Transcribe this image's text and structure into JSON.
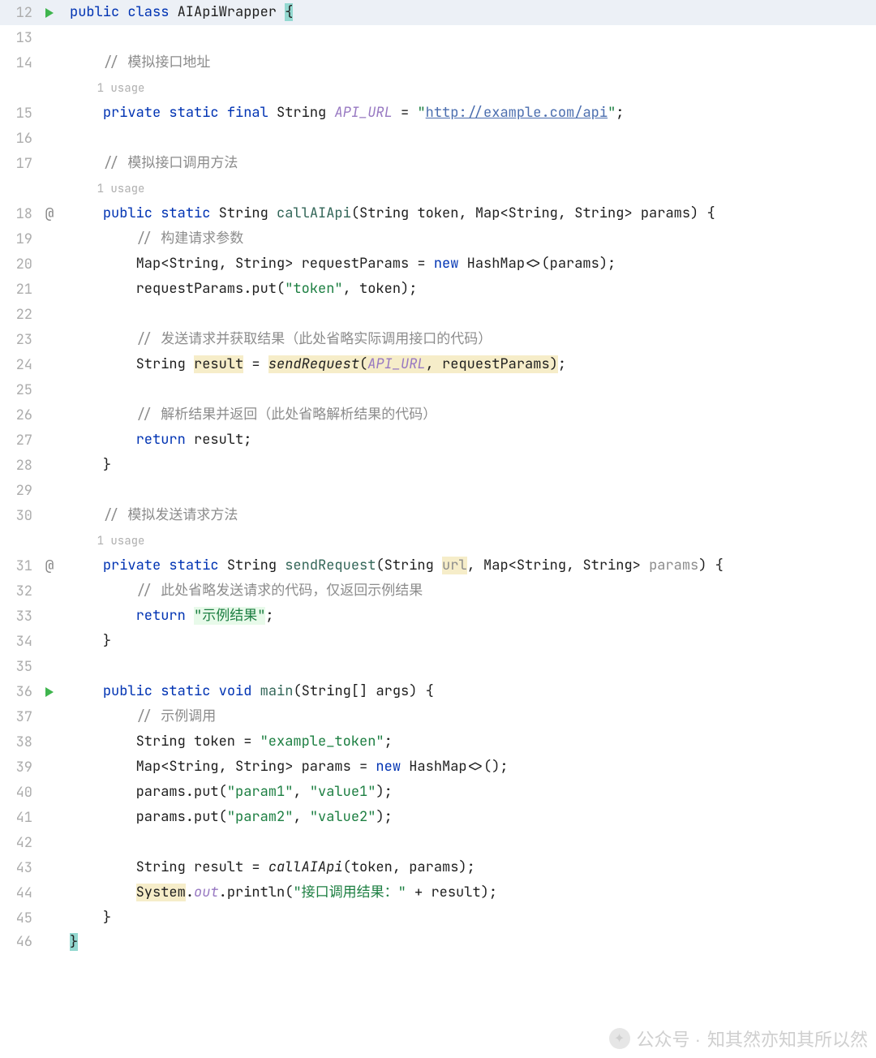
{
  "first_line_number": 12,
  "usage_hint_label": "1 usage",
  "watermark": {
    "prefix": "公众号 ·",
    "text": "知其然亦知其所以然"
  },
  "lines": [
    {
      "n": 12,
      "hl": true,
      "icon": "run",
      "tokens": [
        {
          "t": "public",
          "c": "kw"
        },
        {
          "t": " "
        },
        {
          "t": "class",
          "c": "kw"
        },
        {
          "t": " AIApiWrapper "
        },
        {
          "t": "{",
          "c": "brace-match"
        }
      ]
    },
    {
      "n": 13,
      "tokens": []
    },
    {
      "n": 14,
      "indent": 1,
      "tokens": [
        {
          "t": "// 模拟接口地址",
          "c": "comment"
        }
      ]
    },
    {
      "usage": true,
      "indent": 1
    },
    {
      "n": 15,
      "indent": 1,
      "tokens": [
        {
          "t": "private",
          "c": "kw"
        },
        {
          "t": " "
        },
        {
          "t": "static",
          "c": "kw"
        },
        {
          "t": " "
        },
        {
          "t": "final",
          "c": "kw"
        },
        {
          "t": " String "
        },
        {
          "t": "API_URL",
          "c": "field-static"
        },
        {
          "t": " = "
        },
        {
          "t": "\"",
          "c": "str"
        },
        {
          "t": "http://example.com/api",
          "c": "str link"
        },
        {
          "t": "\"",
          "c": "str"
        },
        {
          "t": ";"
        }
      ]
    },
    {
      "n": 16,
      "tokens": []
    },
    {
      "n": 17,
      "indent": 1,
      "tokens": [
        {
          "t": "// 模拟接口调用方法",
          "c": "comment"
        }
      ]
    },
    {
      "usage": true,
      "indent": 1
    },
    {
      "n": 18,
      "icon": "override",
      "indent": 1,
      "tokens": [
        {
          "t": "public",
          "c": "kw"
        },
        {
          "t": " "
        },
        {
          "t": "static",
          "c": "kw"
        },
        {
          "t": " String "
        },
        {
          "t": "callAIApi",
          "c": "method-decl"
        },
        {
          "t": "(String token, Map<String, String> params) {"
        }
      ]
    },
    {
      "n": 19,
      "indent": 2,
      "tokens": [
        {
          "t": "// 构建请求参数",
          "c": "comment"
        }
      ]
    },
    {
      "n": 20,
      "indent": 2,
      "tokens": [
        {
          "t": "Map<String, String> requestParams = "
        },
        {
          "t": "new",
          "c": "kw"
        },
        {
          "t": " HashMap<>(params);"
        }
      ]
    },
    {
      "n": 21,
      "indent": 2,
      "tokens": [
        {
          "t": "requestParams.put("
        },
        {
          "t": "\"token\"",
          "c": "str"
        },
        {
          "t": ", token);"
        }
      ]
    },
    {
      "n": 22,
      "tokens": []
    },
    {
      "n": 23,
      "indent": 2,
      "tokens": [
        {
          "t": "// 发送请求并获取结果（此处省略实际调用接口的代码）",
          "c": "comment"
        }
      ]
    },
    {
      "n": 24,
      "indent": 2,
      "tokens": [
        {
          "t": "String "
        },
        {
          "t": "result",
          "c": "hl-y"
        },
        {
          "t": " = "
        },
        {
          "t": "sendRequest",
          "c": "method-call hl-y"
        },
        {
          "t": "(",
          "c": "hl-y"
        },
        {
          "t": "API_URL",
          "c": "field-static hl-y"
        },
        {
          "t": ", requestParams)",
          "c": "hl-y"
        },
        {
          "t": ";"
        }
      ]
    },
    {
      "n": 25,
      "tokens": []
    },
    {
      "n": 26,
      "indent": 2,
      "tokens": [
        {
          "t": "// 解析结果并返回（此处省略解析结果的代码）",
          "c": "comment"
        }
      ]
    },
    {
      "n": 27,
      "indent": 2,
      "tokens": [
        {
          "t": "return",
          "c": "kw"
        },
        {
          "t": " result;"
        }
      ]
    },
    {
      "n": 28,
      "indent": 1,
      "tokens": [
        {
          "t": "}"
        }
      ]
    },
    {
      "n": 29,
      "tokens": []
    },
    {
      "n": 30,
      "indent": 1,
      "tokens": [
        {
          "t": "// 模拟发送请求方法",
          "c": "comment"
        }
      ]
    },
    {
      "usage": true,
      "indent": 1
    },
    {
      "n": 31,
      "icon": "override",
      "indent": 1,
      "tokens": [
        {
          "t": "private",
          "c": "kw"
        },
        {
          "t": " "
        },
        {
          "t": "static",
          "c": "kw"
        },
        {
          "t": " String "
        },
        {
          "t": "sendRequest",
          "c": "method-decl"
        },
        {
          "t": "(String "
        },
        {
          "t": "url",
          "c": "param-unused"
        },
        {
          "t": ", Map<String, String> "
        },
        {
          "t": "params",
          "c": "comment"
        },
        {
          "t": ") {"
        }
      ]
    },
    {
      "n": 32,
      "indent": 2,
      "tokens": [
        {
          "t": "// 此处省略发送请求的代码，仅返回示例结果",
          "c": "comment"
        }
      ]
    },
    {
      "n": 33,
      "indent": 2,
      "tokens": [
        {
          "t": "return",
          "c": "kw"
        },
        {
          "t": " "
        },
        {
          "t": "\"示例结果\"",
          "c": "str hl-g"
        },
        {
          "t": ";"
        }
      ]
    },
    {
      "n": 34,
      "indent": 1,
      "tokens": [
        {
          "t": "}"
        }
      ]
    },
    {
      "n": 35,
      "tokens": []
    },
    {
      "n": 36,
      "icon": "run",
      "indent": 1,
      "tokens": [
        {
          "t": "public",
          "c": "kw"
        },
        {
          "t": " "
        },
        {
          "t": "static",
          "c": "kw"
        },
        {
          "t": " "
        },
        {
          "t": "void",
          "c": "kw"
        },
        {
          "t": " "
        },
        {
          "t": "main",
          "c": "method-decl"
        },
        {
          "t": "(String[] args) {"
        }
      ]
    },
    {
      "n": 37,
      "indent": 2,
      "tokens": [
        {
          "t": "// 示例调用",
          "c": "comment"
        }
      ]
    },
    {
      "n": 38,
      "indent": 2,
      "tokens": [
        {
          "t": "String token = "
        },
        {
          "t": "\"example_token\"",
          "c": "str"
        },
        {
          "t": ";"
        }
      ]
    },
    {
      "n": 39,
      "indent": 2,
      "tokens": [
        {
          "t": "Map<String, String> params = "
        },
        {
          "t": "new",
          "c": "kw"
        },
        {
          "t": " HashMap<>();"
        }
      ]
    },
    {
      "n": 40,
      "indent": 2,
      "tokens": [
        {
          "t": "params.put("
        },
        {
          "t": "\"param1\"",
          "c": "str"
        },
        {
          "t": ", "
        },
        {
          "t": "\"value1\"",
          "c": "str"
        },
        {
          "t": ");"
        }
      ]
    },
    {
      "n": 41,
      "indent": 2,
      "tokens": [
        {
          "t": "params.put("
        },
        {
          "t": "\"param2\"",
          "c": "str"
        },
        {
          "t": ", "
        },
        {
          "t": "\"value2\"",
          "c": "str"
        },
        {
          "t": ");"
        }
      ]
    },
    {
      "n": 42,
      "tokens": []
    },
    {
      "n": 43,
      "indent": 2,
      "tokens": [
        {
          "t": "String result = "
        },
        {
          "t": "callAIApi",
          "c": "method-call"
        },
        {
          "t": "(token, params);"
        }
      ]
    },
    {
      "n": 44,
      "indent": 2,
      "tokens": [
        {
          "t": "System",
          "c": "hl-y"
        },
        {
          "t": "."
        },
        {
          "t": "out",
          "c": "static-out"
        },
        {
          "t": ".println("
        },
        {
          "t": "\"接口调用结果：\"",
          "c": "str"
        },
        {
          "t": " + result);"
        }
      ]
    },
    {
      "n": 45,
      "indent": 1,
      "tokens": [
        {
          "t": "}"
        }
      ]
    },
    {
      "n": 46,
      "tokens": [
        {
          "t": "}",
          "c": "brace-match"
        }
      ]
    }
  ]
}
